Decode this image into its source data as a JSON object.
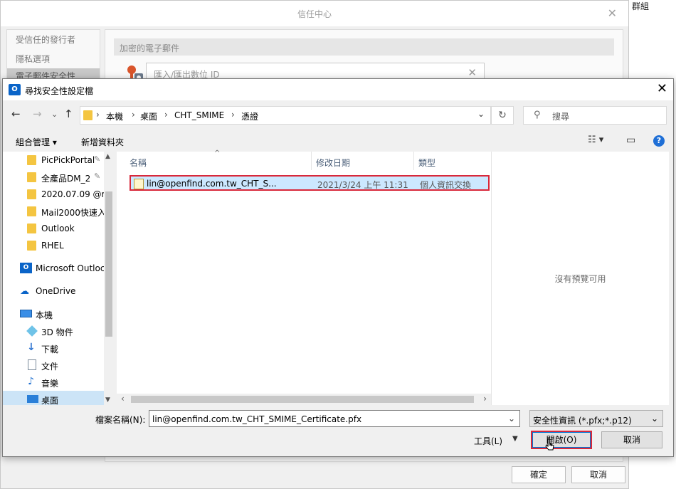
{
  "background_window": {
    "title": "信任中心",
    "sidebar_items": [
      "受信任的發行者",
      "隱私選項",
      "電子郵件安全性"
    ],
    "section_title": "加密的電子郵件",
    "inner_dialog_title": "匯入/匯出數位 ID",
    "ok_label": "確定",
    "cancel_label": "取消",
    "group_label": "群組"
  },
  "dialog": {
    "title": "尋找安全性設定檔",
    "icon_text": "O",
    "close_glyph": "✕",
    "breadcrumb": [
      "本機",
      "桌面",
      "CHT_SMIME",
      "憑證"
    ],
    "search_placeholder": "搜尋",
    "toolbar": {
      "organize_label": "組合管理 ▾",
      "new_folder_label": "新增資料夾"
    },
    "nav_items": [
      {
        "label": "PicPickPortal",
        "pinned": true,
        "type": "folder"
      },
      {
        "label": "全產品DM_2",
        "pinned": true,
        "type": "folder"
      },
      {
        "label": "2020.07.09 @m",
        "pinned": false,
        "type": "folder"
      },
      {
        "label": "Mail2000快速入",
        "pinned": false,
        "type": "folder"
      },
      {
        "label": "Outlook",
        "pinned": false,
        "type": "folder"
      },
      {
        "label": "RHEL",
        "pinned": false,
        "type": "folder"
      },
      {
        "label": "Microsoft Outloc",
        "pinned": false,
        "type": "outlook"
      },
      {
        "label": "OneDrive",
        "pinned": false,
        "type": "onedrive"
      },
      {
        "label": "本機",
        "pinned": false,
        "type": "pc"
      },
      {
        "label": "3D 物件",
        "pinned": false,
        "type": "3d"
      },
      {
        "label": "下載",
        "pinned": false,
        "type": "download"
      },
      {
        "label": "文件",
        "pinned": false,
        "type": "document"
      },
      {
        "label": "音樂",
        "pinned": false,
        "type": "music"
      },
      {
        "label": "桌面",
        "pinned": false,
        "type": "desktop"
      }
    ],
    "columns": {
      "name": "名稱",
      "modified": "修改日期",
      "type": "類型"
    },
    "files": [
      {
        "name": "lin@openfind.com.tw_CHT_S...",
        "modified": "2021/3/24 上午 11:31",
        "type": "個人資訊交換",
        "selected": true
      }
    ],
    "preview_text": "沒有預覽可用",
    "filename_label": "檔案名稱(N):",
    "filename_value": "lin@openfind.com.tw_CHT_SMIME_Certificate.pfx",
    "filetype_value": "安全性資訊 (*.pfx;*.p12)",
    "tools_label": "工具(L)",
    "open_label": "開啟(O)",
    "cancel_label": "取消"
  },
  "colors": {
    "accent": "#0078d7",
    "highlight_border": "#d9283a",
    "selection": "#cce8ff",
    "folder": "#f4c541"
  }
}
